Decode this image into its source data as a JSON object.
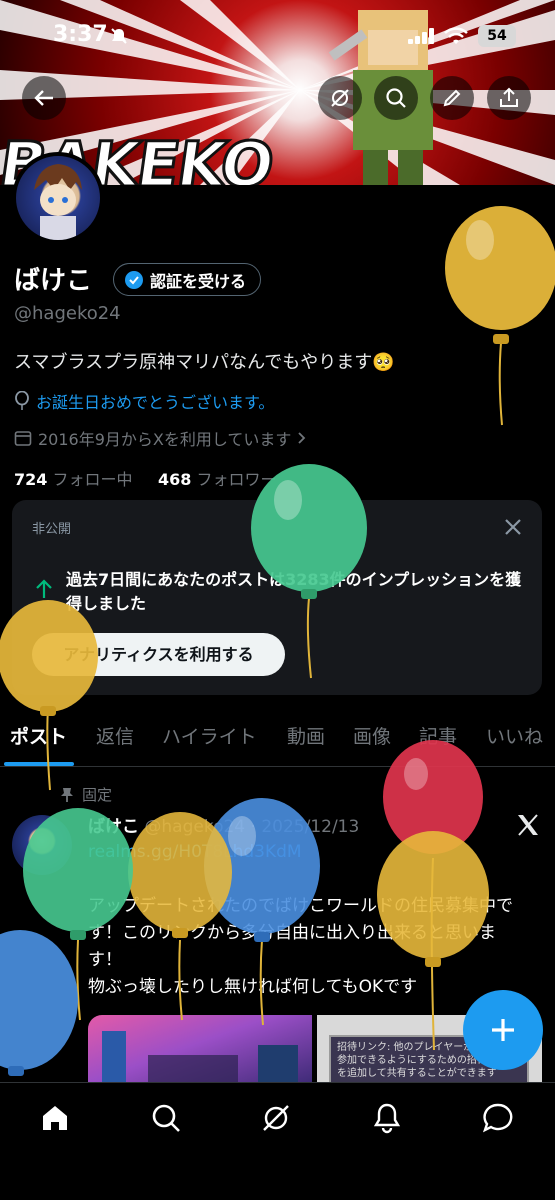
{
  "status_bar": {
    "time": "3:37",
    "battery": "54"
  },
  "banner": {
    "word": "BAKEKO"
  },
  "profile": {
    "name": "ばけこ",
    "verify_label": "認証を受ける",
    "handle": "@hageko24",
    "bio": "スマブラスプラ原神マリパなんでもやります🥺",
    "birthday": "お誕生日おめでとうございます。",
    "joined": "2016年9月からXを利用しています",
    "following_count": "724",
    "following_label": "フォロー中",
    "followers_count": "468",
    "followers_label": "フォロワー"
  },
  "private_card": {
    "label": "非公開",
    "text": "過去7日間にあなたのポストは3283件のインプレッションを獲得しました",
    "button": "アナリティクスを利用する"
  },
  "tabs": [
    {
      "label": "ポスト"
    },
    {
      "label": "返信"
    },
    {
      "label": "ハイライト"
    },
    {
      "label": "動画"
    },
    {
      "label": "画像"
    },
    {
      "label": "記事"
    },
    {
      "label": "いいね"
    }
  ],
  "post": {
    "pinned_label": "固定",
    "author": "ばけこ",
    "meta": "@hageko24 · 2025/12/13",
    "link": "realms.gg/H0T8Lhd3KdM",
    "body": "アップデートされたのでばけこワールドの住民募集中です！このリンクから多分自由に出入り出来ると思います！\n物ぶっ壊したりし無ければ何してもOKです",
    "media_text": "招待リンク:\n他のプレイヤーが Realm に参加できるようにするための招待リンクを追加して共有することができます"
  },
  "colors": {
    "accent": "#1d9bf0",
    "background": "#000000",
    "card": "#16181c"
  }
}
